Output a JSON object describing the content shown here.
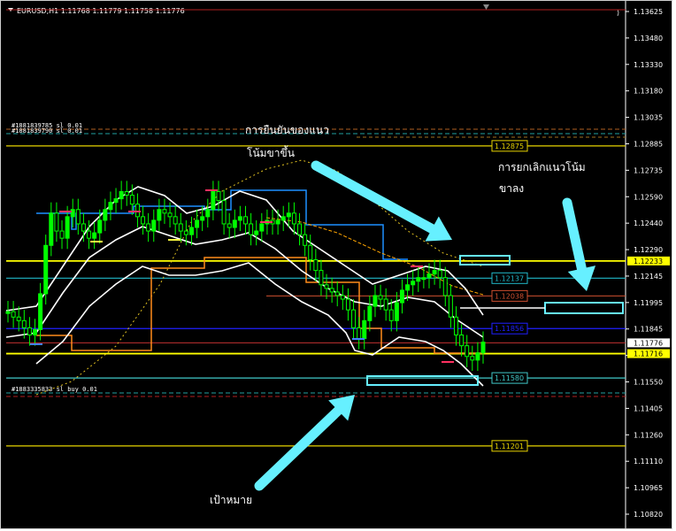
{
  "header": {
    "symbol_line": "EURUSD,H1  1.11768 1.11779 1.11758 1.11776",
    "scroll_icon": "right-shift-marker"
  },
  "chart_data": {
    "type": "line",
    "title": "",
    "xlabel": "",
    "ylabel": "",
    "ylim": [
      1.1075,
      1.1368
    ],
    "grid": false,
    "y_ticks": [
      "1.13625",
      "1.13480",
      "1.13330",
      "1.13180",
      "1.13035",
      "1.12885",
      "1.12735",
      "1.12590",
      "1.12440",
      "1.12290",
      "1.12145",
      "1.11995",
      "1.11845",
      "1.11700",
      "1.11550",
      "1.11405",
      "1.11260",
      "1.11110",
      "1.10965",
      "1.10820"
    ],
    "current_price": "1.11776",
    "price_series": [
      1.1195,
      1.1192,
      1.119,
      1.1186,
      1.1182,
      1.1185,
      1.1205,
      1.1232,
      1.125,
      1.124,
      1.1236,
      1.1248,
      1.1252,
      1.1244,
      1.124,
      1.1236,
      1.1239,
      1.1246,
      1.1252,
      1.1256,
      1.1258,
      1.1262,
      1.126,
      1.1255,
      1.1248,
      1.1244,
      1.124,
      1.1246,
      1.1252,
      1.125,
      1.1248,
      1.1244,
      1.124,
      1.1238,
      1.1242,
      1.1246,
      1.1248,
      1.1252,
      1.1262,
      1.1257,
      1.1244,
      1.1242,
      1.1246,
      1.1248,
      1.1244,
      1.1238,
      1.124,
      1.1244,
      1.1246,
      1.1244,
      1.1246,
      1.1248,
      1.125,
      1.1244,
      1.1238,
      1.1232,
      1.1224,
      1.1218,
      1.121,
      1.1208,
      1.1206,
      1.1204,
      1.1202,
      1.1196,
      1.1186,
      1.118,
      1.119,
      1.1198,
      1.1204,
      1.1202,
      1.1196,
      1.119,
      1.12,
      1.1207,
      1.121,
      1.1212,
      1.1214,
      1.1214,
      1.1216,
      1.1218,
      1.1214,
      1.1204,
      1.1192,
      1.1182,
      1.1176,
      1.117,
      1.1168,
      1.1172,
      1.1178
    ],
    "levels": [
      {
        "label": "1.12875",
        "value": 1.12875,
        "color": "#e6d200",
        "shown": true
      },
      {
        "label": "1.12233",
        "value": 1.12233,
        "color": "#ffff00",
        "shown": true,
        "highlight": true
      },
      {
        "label": "1.12137",
        "value": 1.12137,
        "color": "#20b8c8",
        "shown": true
      },
      {
        "label": "1.12038",
        "value": 1.12038,
        "color": "#d05030",
        "shown": true
      },
      {
        "label": "1.11856",
        "value": 1.11856,
        "color": "#2020ff",
        "shown": true
      },
      {
        "label": "1.11716",
        "value": 1.11716,
        "color": "#ffff00",
        "shown": true,
        "highlight": true
      },
      {
        "label": "1.11580",
        "value": 1.1158,
        "color": "#40c8c8",
        "shown": true
      },
      {
        "label": "1.11201",
        "value": 1.11201,
        "color": "#e6d200",
        "shown": true
      }
    ],
    "order_labels": [
      "#1881839785 sl 0.01",
      "#1881839790 sl 0.01",
      "#1883335833 sl buy 0.01"
    ]
  },
  "annotations": {
    "confirm_uptrend": [
      "การยืนยันของแนว",
      "โน้มขาขึ้น"
    ],
    "cancel_downtrend": [
      "การยกเลิกแนวโน้ม",
      "ขาลง"
    ],
    "target": "เป้าหมาย"
  },
  "colors": {
    "background": "#000000",
    "candle": "#00ff00",
    "annotation_arrow": "#66f0ff",
    "bollinger": "#ffffff",
    "step_line_blue": "#1e90ff",
    "step_line_orange": "#ff8c1a",
    "ma_dotted": "#e0c020"
  }
}
